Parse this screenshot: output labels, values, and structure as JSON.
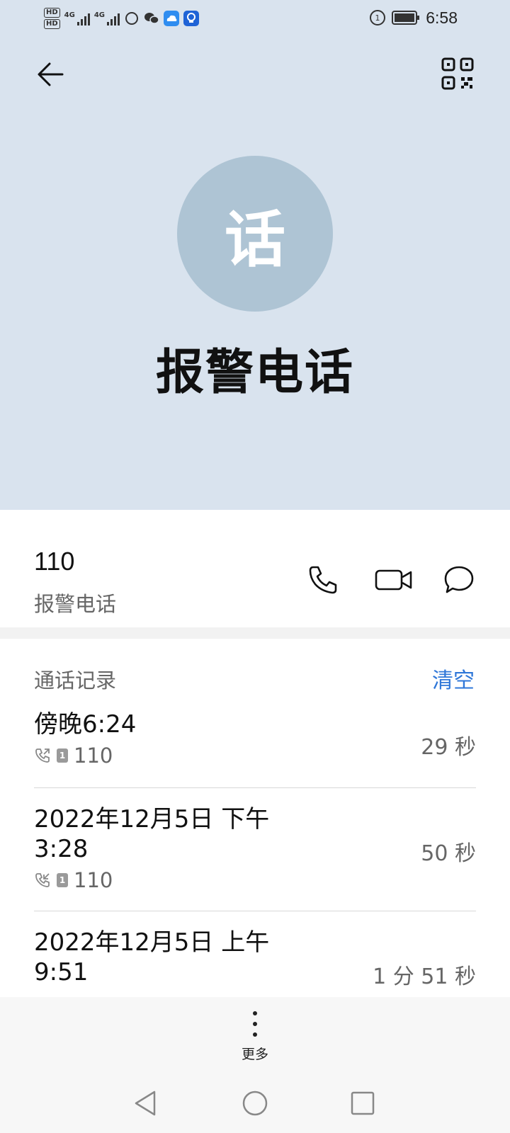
{
  "status_bar": {
    "sim1_badge": "HD",
    "sim2_badge": "HD",
    "network1": "4G",
    "network2": "4G",
    "time": "6:58",
    "icons": [
      "hd-icon",
      "signal-icon",
      "loading-icon",
      "wechat-icon",
      "cloud-icon",
      "bulb-icon",
      "data-saver-icon",
      "battery-icon"
    ]
  },
  "header": {
    "back_icon": "arrow-left-icon",
    "qr_icon": "qr-code-icon",
    "avatar_char": "话",
    "avatar_color": "#aec4d4",
    "background": "#d9e3ee"
  },
  "contact": {
    "name": "报警电话",
    "number": "110",
    "number_label": "报警电话",
    "actions": [
      "phone-icon",
      "video-call-icon",
      "message-icon"
    ]
  },
  "call_log": {
    "title": "通话记录",
    "clear_label": "清空",
    "accent": "#2f77d8",
    "entries": [
      {
        "datetime": "傍晚6:24",
        "number": "110",
        "sim": "1",
        "direction": "outgoing",
        "duration": "29 秒"
      },
      {
        "datetime_line1": "2022年12月5日 下午",
        "datetime_line2": "3:28",
        "number": "110",
        "sim": "1",
        "direction": "incoming",
        "duration": "50 秒"
      },
      {
        "datetime_line1": "2022年12月5日 上午",
        "datetime_line2": "9:51",
        "duration": "1 分 51 秒"
      }
    ]
  },
  "bottom": {
    "more_label": "更多",
    "nav": [
      "back-triangle-icon",
      "home-circle-icon",
      "recents-square-icon"
    ]
  }
}
